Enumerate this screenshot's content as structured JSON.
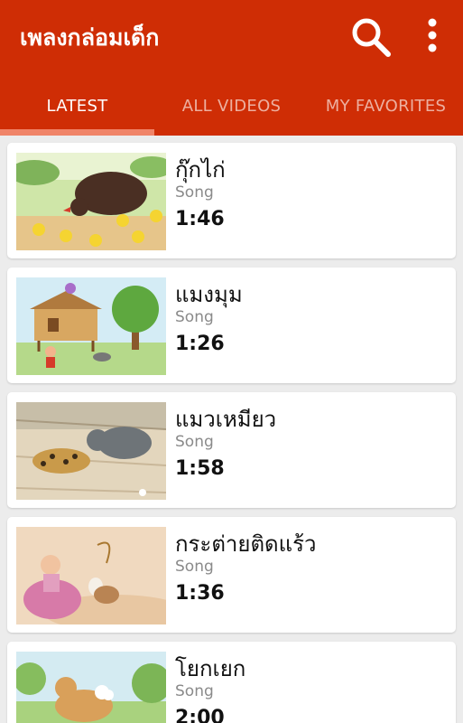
{
  "app": {
    "title": "เพลงกล่อมเด็ก",
    "accent": "#cf2d05",
    "indicator_color": "#f08468"
  },
  "toolbar": {
    "search_icon": "search-icon",
    "menu_icon": "more-vert-icon"
  },
  "tabs": [
    {
      "label": "LATEST",
      "active": true
    },
    {
      "label": "ALL VIDEOS",
      "active": false
    },
    {
      "label": "MY FAVORITES",
      "active": false
    }
  ],
  "videos": [
    {
      "title": "กุ๊กไก่",
      "type": "Song",
      "duration": "1:46"
    },
    {
      "title": "แมงมุม",
      "type": "Song",
      "duration": "1:26"
    },
    {
      "title": "แมวเหมียว",
      "type": "Song",
      "duration": "1:58"
    },
    {
      "title": "กระต่ายติดแร้ว",
      "type": "Song",
      "duration": "1:36"
    },
    {
      "title": "โยกเยก",
      "type": "Song",
      "duration": "2:00"
    }
  ]
}
